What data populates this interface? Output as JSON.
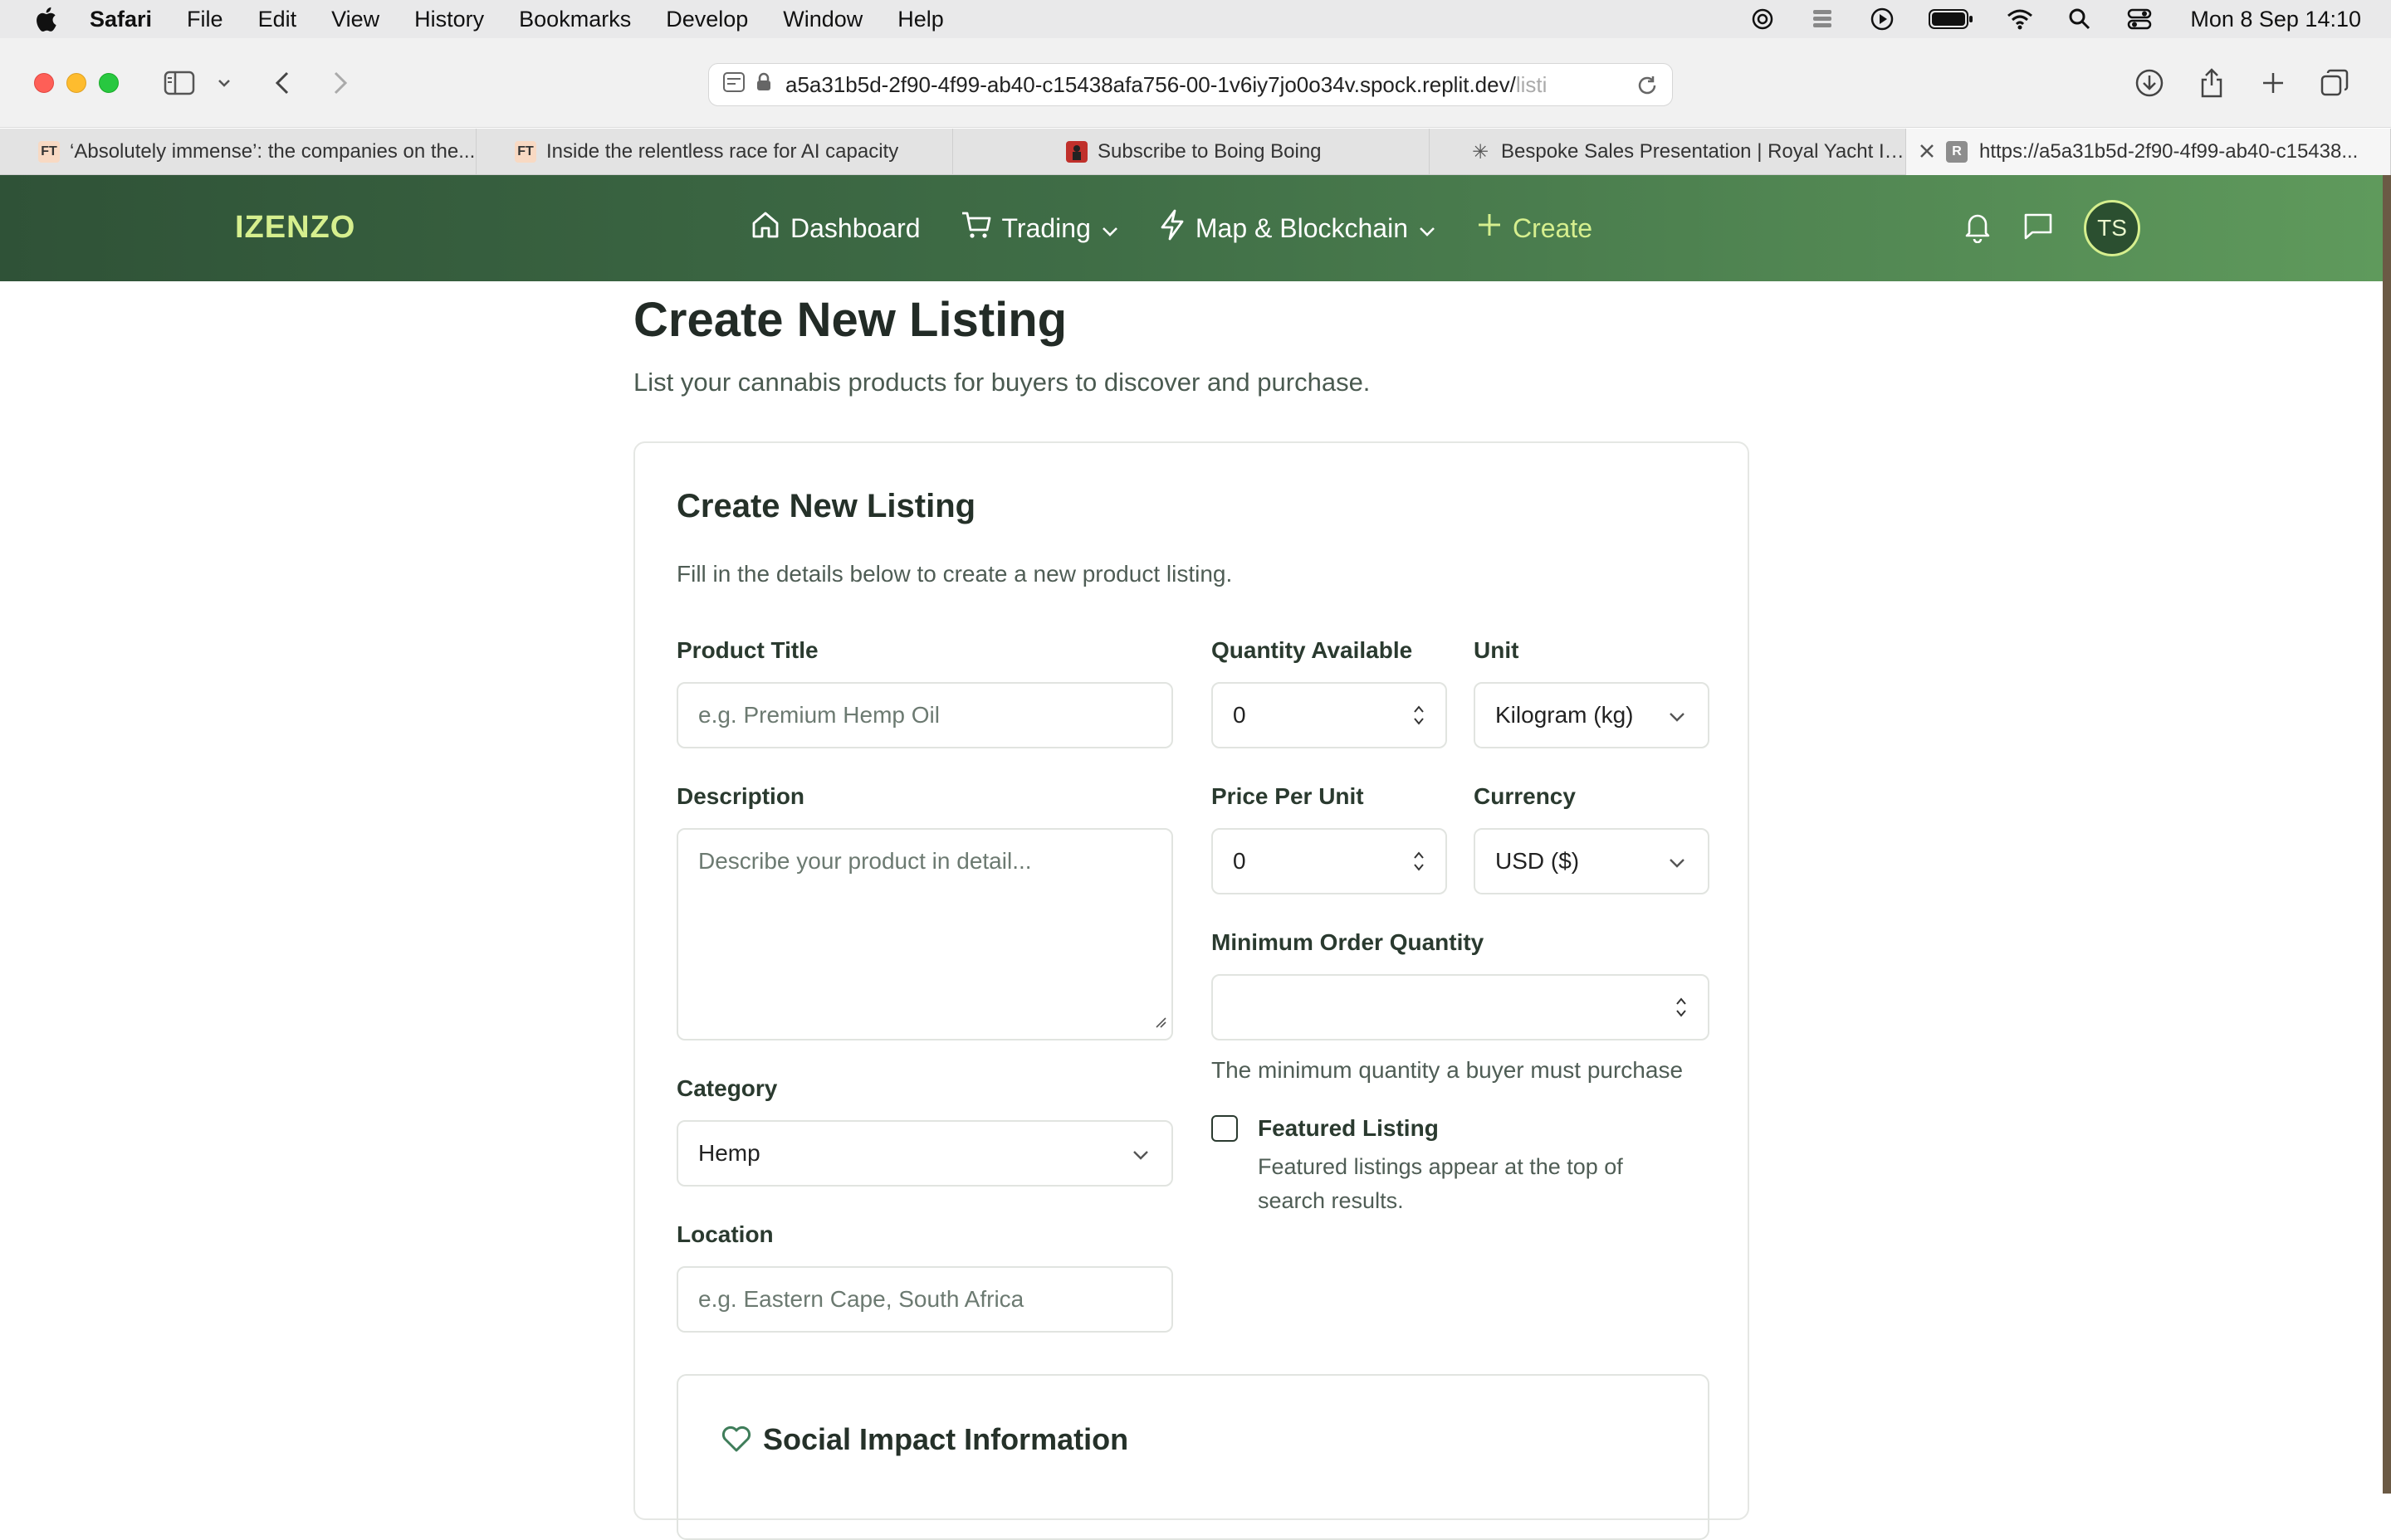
{
  "menubar": {
    "app": "Safari",
    "items": [
      "File",
      "Edit",
      "View",
      "History",
      "Bookmarks",
      "Develop",
      "Window",
      "Help"
    ],
    "clock": "Mon 8 Sep  14:10"
  },
  "browser": {
    "url": "a5a31b5d-2f90-4f99-ab40-c15438afa756-00-1v6iy7jo0o34v.spock.replit.dev/",
    "url_fade": "listi",
    "tabs": [
      {
        "favicon": "FT",
        "title": "‘Absolutely immense’: the companies on the..."
      },
      {
        "favicon": "FT",
        "title": "Inside the relentless race for AI capacity"
      },
      {
        "favicon": "",
        "title": "Subscribe to Boing Boing"
      },
      {
        "favicon": "✳",
        "title": "Bespoke Sales Presentation | Royal Yacht Int..."
      },
      {
        "favicon": "R",
        "title": "https://a5a31b5d-2f90-4f99-ab40-c15438..."
      }
    ]
  },
  "header": {
    "brand": "IZENZO",
    "nav": {
      "dashboard": "Dashboard",
      "trading": "Trading",
      "map": "Map & Blockchain",
      "create": "Create"
    },
    "avatar_initials": "TS"
  },
  "page": {
    "title": "Create New Listing",
    "subtitle": "List your cannabis products for buyers to discover and purchase."
  },
  "form": {
    "title": "Create New Listing",
    "description": "Fill in the details below to create a new product listing.",
    "product_title": {
      "label": "Product Title",
      "placeholder": "e.g. Premium Hemp Oil"
    },
    "description_field": {
      "label": "Description",
      "placeholder": "Describe your product in detail..."
    },
    "category": {
      "label": "Category",
      "value": "Hemp"
    },
    "location": {
      "label": "Location",
      "placeholder": "e.g. Eastern Cape, South Africa"
    },
    "quantity": {
      "label": "Quantity Available",
      "value": "0"
    },
    "unit": {
      "label": "Unit",
      "value": "Kilogram (kg)"
    },
    "price": {
      "label": "Price Per Unit",
      "value": "0"
    },
    "currency": {
      "label": "Currency",
      "value": "USD ($)"
    },
    "min_order": {
      "label": "Minimum Order Quantity",
      "value": "",
      "hint": "The minimum quantity a buyer must purchase"
    },
    "featured": {
      "label": "Featured Listing",
      "checked": false,
      "hint": "Featured listings appear at the top of search results."
    },
    "social_impact": {
      "title": "Social Impact Information"
    }
  },
  "colors": {
    "header_start": "#2f5237",
    "header_end": "#5f9a5c",
    "accent": "#d6ef8e",
    "impact_icon": "#3f7d5a"
  }
}
